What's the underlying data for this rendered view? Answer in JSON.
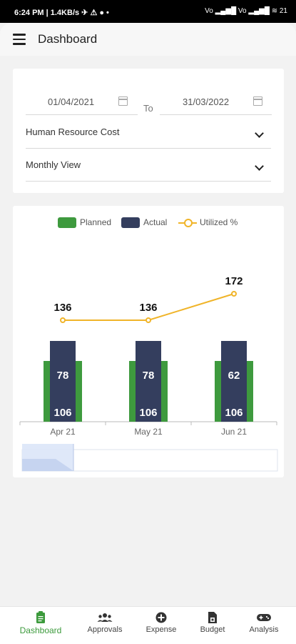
{
  "status": {
    "left": "6:24 PM | 1.4KB/s ✈ ⚠ ●  •",
    "right": "Vo ▂▄▆█ Vo ▂▄▆█ ≋ 21"
  },
  "header": {
    "title": "Dashboard"
  },
  "filters": {
    "from_date": "01/04/2021",
    "to_label": "To",
    "to_date": "31/03/2022",
    "category": "Human Resource Cost",
    "view": "Monthly View"
  },
  "legend": {
    "planned": "Planned",
    "actual": "Actual",
    "utilized": "Utilized %"
  },
  "colors": {
    "planned": "#3e9a3e",
    "actual": "#343e5e",
    "utilized": "#f0b429",
    "accent": "#3c9a3c"
  },
  "chart_data": {
    "type": "bar",
    "categories": [
      "Apr 21",
      "May 21",
      "Jun 21"
    ],
    "series": [
      {
        "name": "Planned",
        "values": [
          106,
          106,
          106
        ]
      },
      {
        "name": "Actual",
        "values": [
          78,
          78,
          62
        ]
      },
      {
        "name": "Utilized %",
        "values": [
          136,
          136,
          172
        ]
      }
    ]
  },
  "nav": {
    "items": [
      {
        "label": "Dashboard",
        "icon": "clipboard-icon",
        "active": true
      },
      {
        "label": "Approvals",
        "icon": "people-icon",
        "active": false
      },
      {
        "label": "Expense",
        "icon": "plus-circle-icon",
        "active": false
      },
      {
        "label": "Budget",
        "icon": "budget-doc-icon",
        "active": false
      },
      {
        "label": "Analysis",
        "icon": "gamepad-icon",
        "active": false
      }
    ]
  }
}
